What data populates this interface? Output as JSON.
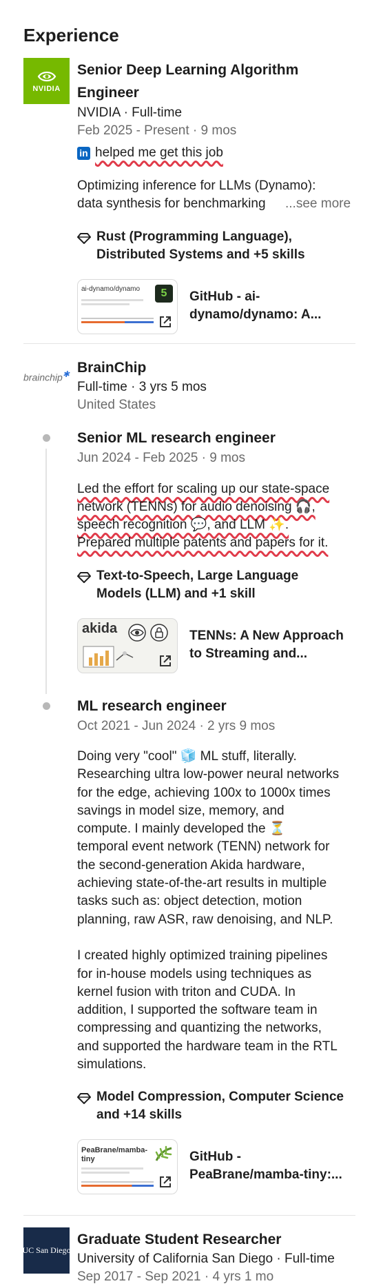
{
  "section_title": "Experience",
  "nvidia": {
    "logo_text": "NVIDIA",
    "title_line1": "Senior Deep Learning Algorithm",
    "title_line2": "Engineer",
    "company": "NVIDIA · Full-time",
    "dates": "Feb 2025 - Present · 9 mos",
    "badge_text": "helped me get this job",
    "desc_line1": "Optimizing inference for LLMs (Dynamo):",
    "desc_line2": "data synthesis for benchmarking",
    "see_more": "...see more",
    "skills_line1": "Rust (Programming Language),",
    "skills_line2": "Distributed Systems and +5 skills",
    "media": {
      "thumb_title": "ai-dynamo/dynamo",
      "title_line1": "GitHub - ai-",
      "title_line2": "dynamo/dynamo: A..."
    }
  },
  "brainchip": {
    "logo_text": "brainchip",
    "company": "BrainChip",
    "type_duration": "Full-time · 3 yrs 5 mos",
    "location": "United States",
    "roles": [
      {
        "title": "Senior ML research engineer",
        "dates": "Jun 2024 - Feb 2025 · 9 mos",
        "desc": [
          "Led the effort for scaling up our state-space",
          "network (TENNs) for audio denoising 🎧,",
          "speech recognition 💬, and LLM ✨.",
          "Prepared multiple patents and papers for it."
        ],
        "skills_line1": "Text-to-Speech, Large Language",
        "skills_line2": "Models (LLM) and +1 skill",
        "media": {
          "thumb_title": "akida",
          "title_line1": "TENNs: A New Approach",
          "title_line2": "to Streaming and..."
        }
      },
      {
        "title": "ML research engineer",
        "dates": "Oct 2021 - Jun 2024 · 2 yrs 9 mos",
        "desc": [
          "Doing very \"cool\" 🧊 ML stuff, literally.",
          "Researching ultra low-power neural networks",
          "for the edge, achieving 100x to 1000x times",
          "savings in model size, memory, and",
          "compute. I mainly developed the ⏳",
          "temporal event network (TENN) network for",
          "the second-generation Akida hardware,",
          "achieving state-of-the-art results in multiple",
          "tasks such as: object detection, motion",
          "planning, raw ASR, raw denoising, and NLP.",
          "",
          "I created highly optimized training pipelines",
          "for in-house models using techniques as",
          "kernel fusion with triton and CUDA. In",
          "addition, I supported the software team in",
          "compressing and quantizing the networks,",
          "and supported the hardware team in the RTL",
          "simulations."
        ],
        "skills_line1": "Model Compression, Computer Science",
        "skills_line2": "and +14 skills",
        "media": {
          "thumb_title": "PeaBrane/mamba-tiny",
          "title_line1": "GitHub -",
          "title_line2": "PeaBrane/mamba-tiny:..."
        }
      }
    ]
  },
  "ucsd": {
    "logo_text": "UC San Diego",
    "title": "Graduate Student Researcher",
    "company": "University of California San Diego · Full-time",
    "dates": "Sep 2017 - Sep 2021 · 4 yrs 1 mo"
  },
  "colors": {
    "nvidia_green": "#76b900",
    "ucsd_navy": "#182b49",
    "linkedin_blue": "#0a66c2",
    "highlight_red": "#e03b4a"
  }
}
